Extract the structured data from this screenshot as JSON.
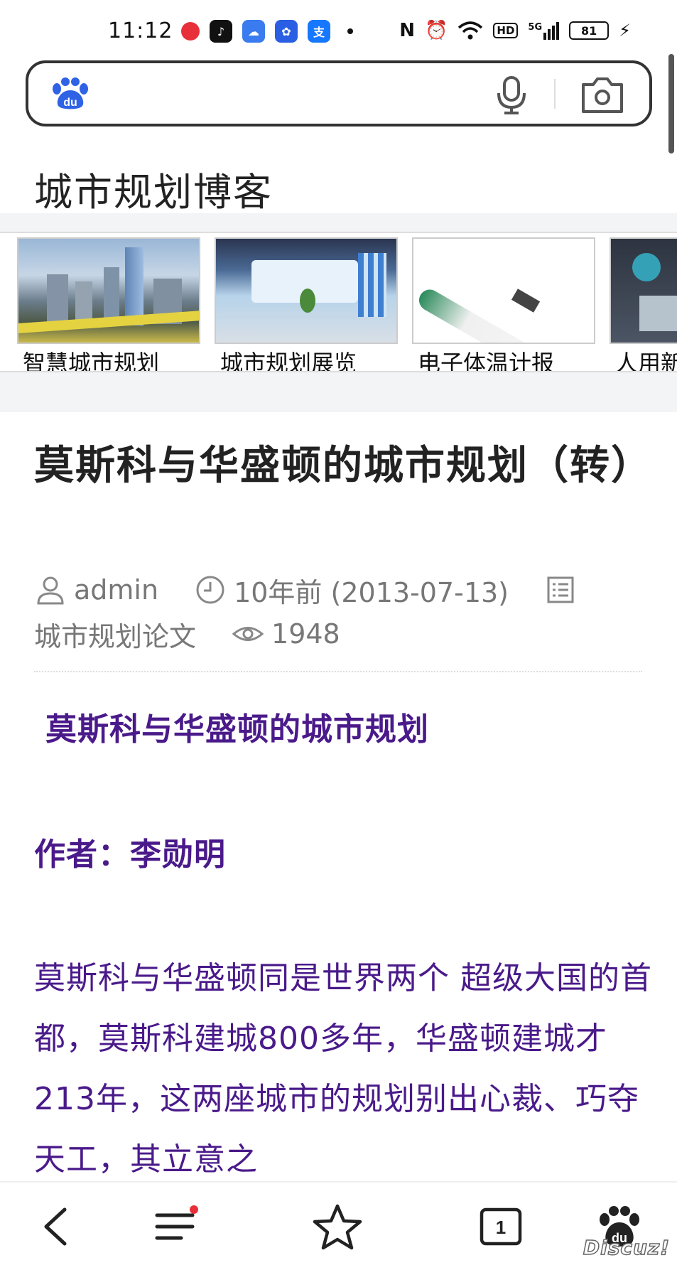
{
  "status_bar": {
    "time": "11:12",
    "signal_label": "5G",
    "hd_label": "HD",
    "battery": "81",
    "apps": [
      {
        "icon": "video-app-icon",
        "color": "#e8303a"
      },
      {
        "icon": "tiktok-icon",
        "color": "#111111"
      },
      {
        "icon": "baidu-cloud-icon",
        "color": "#3a7bef"
      },
      {
        "icon": "baidu-app-icon",
        "color": "#2b5fe3"
      },
      {
        "icon": "alipay-icon",
        "color": "#1677ff"
      }
    ]
  },
  "search": {
    "placeholder": "",
    "logo_label": "du",
    "mic_icon": "microphone-icon",
    "camera_icon": "camera-icon"
  },
  "blog": {
    "title": "城市规划博客"
  },
  "carousel": {
    "items": [
      {
        "label": "智慧城市规划",
        "image": "smart-city-image"
      },
      {
        "label": "城市规划展览",
        "image": "exhibition-hall-image"
      },
      {
        "label": "电子体温计报",
        "image": "thermometer-image"
      },
      {
        "label": "人用新",
        "image": "product-image"
      }
    ]
  },
  "article": {
    "title": "莫斯科与华盛顿的城市规划（转）",
    "author": "admin",
    "time": "10年前 (2013-07-13)",
    "category": "城市规划论文",
    "views": "1948",
    "heading": "莫斯科与华盛顿的城市规划",
    "author_line": "作者：李勋明",
    "body": "莫斯科与华盛顿同是世界两个 超级大国的首都，莫斯科建城800多年，华盛顿建城才213年，这两座城市的规划别出心裁、巧夺天工，其立意之"
  },
  "bottom_nav": {
    "tab_count": "1",
    "logo_label": "du",
    "watermark": "Discuz!"
  },
  "colors": {
    "content_text": "#4a1a8a",
    "accent_blue": "#2f63e6",
    "notification_dot": "#e8303a"
  }
}
